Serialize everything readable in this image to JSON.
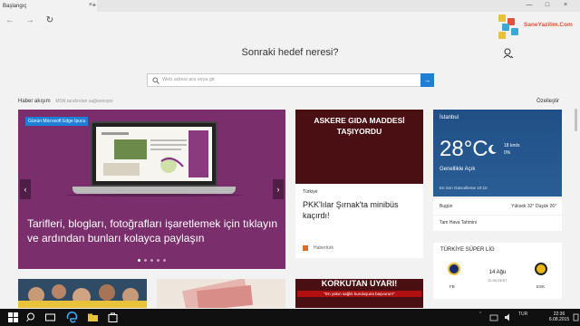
{
  "browser": {
    "tab_title": "Başlangıç",
    "tab_close": "×",
    "new_tab": "+"
  },
  "window_controls": [
    "—",
    "□",
    "×"
  ],
  "toolbar": {
    "back": "←",
    "forward": "→",
    "refresh": "↻"
  },
  "logo": {
    "text": "SaneYazilim.Com"
  },
  "hero": {
    "title": "Sonraki hedef neresi?"
  },
  "search": {
    "placeholder": "Web adresi ara veya git",
    "go": "→"
  },
  "news_header": {
    "label": "Haber akışım",
    "sublabel": "MSN tarafından sağlanmıştır",
    "customize": "Özelleştir"
  },
  "feature": {
    "tag": "Günün Microsoft Edge İpucu",
    "title": "Tarifleri, blogları, fotoğrafları işaretlemek için tıklayın ve ardından bunları kolayca paylaşın",
    "prev": "‹",
    "next": "›",
    "slides": 5,
    "active_slide": 0
  },
  "side_news": {
    "image_text": "ASKERE GIDA MADDESİ TAŞIYORDU",
    "category": "Türkiye",
    "title": "PKK'lılar Şırnak'ta minibüs kaçırdı!",
    "source": "Habertürk"
  },
  "weather": {
    "city": "İstanbul",
    "temp": "28°C",
    "wind": "18 km/s",
    "precip": "0%",
    "condition": "Genellikle Açık",
    "updated": "En Son Güncelleme 10:10",
    "today_label": "Bugün",
    "today_value": "Yüksek 32° Düşük 26°",
    "hourly_label": "Tam Hava Tahmini"
  },
  "sports": {
    "title": "TÜRKİYE SÜPER LİG",
    "home": "FB",
    "away": "ESK",
    "date": "14 Ağu",
    "time": "22:00 EEST",
    "home_color": "#1b2a6b",
    "away_color": "#e8b814"
  },
  "bottom_cards": [
    {
      "title": "KORKUTAN UYARI!",
      "sub": "\"En yakın sağlık kuruluşuna başvurun!\""
    }
  ],
  "taskbar": {
    "tray_lang": "TUR",
    "clock_time": "22:36",
    "clock_date": "6.08.2015"
  },
  "colors": {
    "accent": "#1e7fd6",
    "feature_bg": "#7a2e6c",
    "weather_bg": "#2b5e96"
  }
}
